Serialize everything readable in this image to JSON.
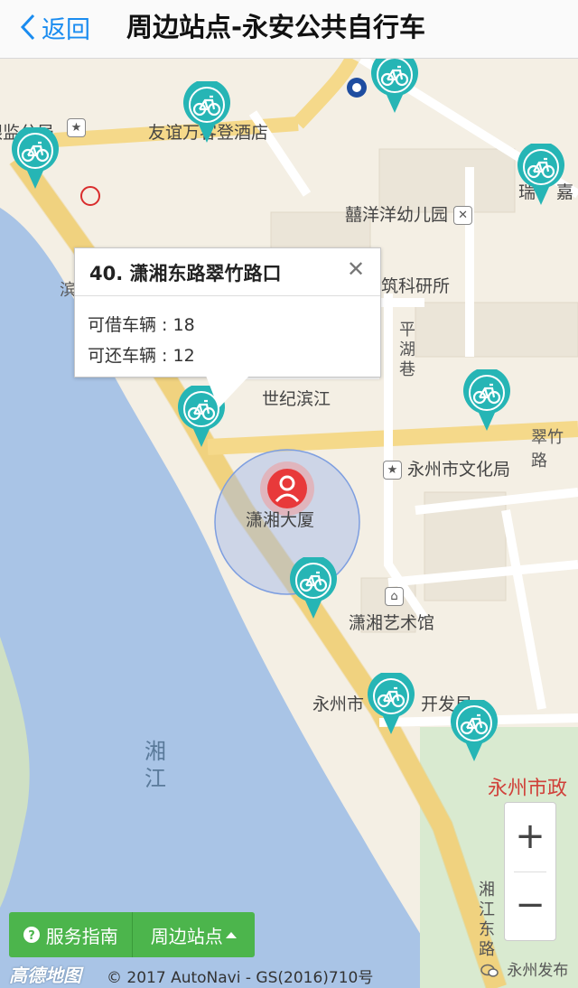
{
  "header": {
    "back_label": "返回",
    "title": "周边站点-永安公共自行车"
  },
  "map": {
    "pois": [
      {
        "label": "友谊万客登酒店",
        "icon": "hotel-icon"
      },
      {
        "label": "囍洋洋幼儿园",
        "icon": "school-icon"
      },
      {
        "label": "筑科研所",
        "icon": ""
      },
      {
        "label": "世纪滨江",
        "icon": ""
      },
      {
        "label": "永州市文化局",
        "icon": "government-icon"
      },
      {
        "label": "潇湘大厦",
        "icon": ""
      },
      {
        "label": "潇湘艺术馆",
        "icon": "museum-icon"
      },
      {
        "label": "永州市",
        "icon": ""
      },
      {
        "label": "开发局",
        "icon": ""
      },
      {
        "label": "永州市政",
        "icon": ""
      },
      {
        "label": "瑞",
        "icon": ""
      },
      {
        "label": "嘉",
        "icon": ""
      },
      {
        "label": "银监分局",
        "icon": ""
      }
    ],
    "road_labels": [
      "平湖巷",
      "翠竹路",
      "滨",
      "湘江东路"
    ],
    "river_label": "湘江",
    "colors": {
      "station": "#26b5b5",
      "river": "#a9c4e6",
      "land": "#f4efe4",
      "road": "#f5d98a",
      "park": "#d9ead0",
      "user_marker": "#e8393a"
    }
  },
  "popup": {
    "title": "40. 潇湘东路翠竹路口",
    "close": "✕",
    "borrow_label": "可借车辆 : 18",
    "return_label": "可还车辆 : 12"
  },
  "zoom": {
    "in": "+",
    "out": "−"
  },
  "bottom_bar": {
    "guide_label": "服务指南",
    "nearby_label": "周边站点"
  },
  "footer": {
    "logo": "高德地图",
    "copyright": "© 2017 AutoNavi - GS(2016)710号",
    "watermark": "永州发布"
  }
}
